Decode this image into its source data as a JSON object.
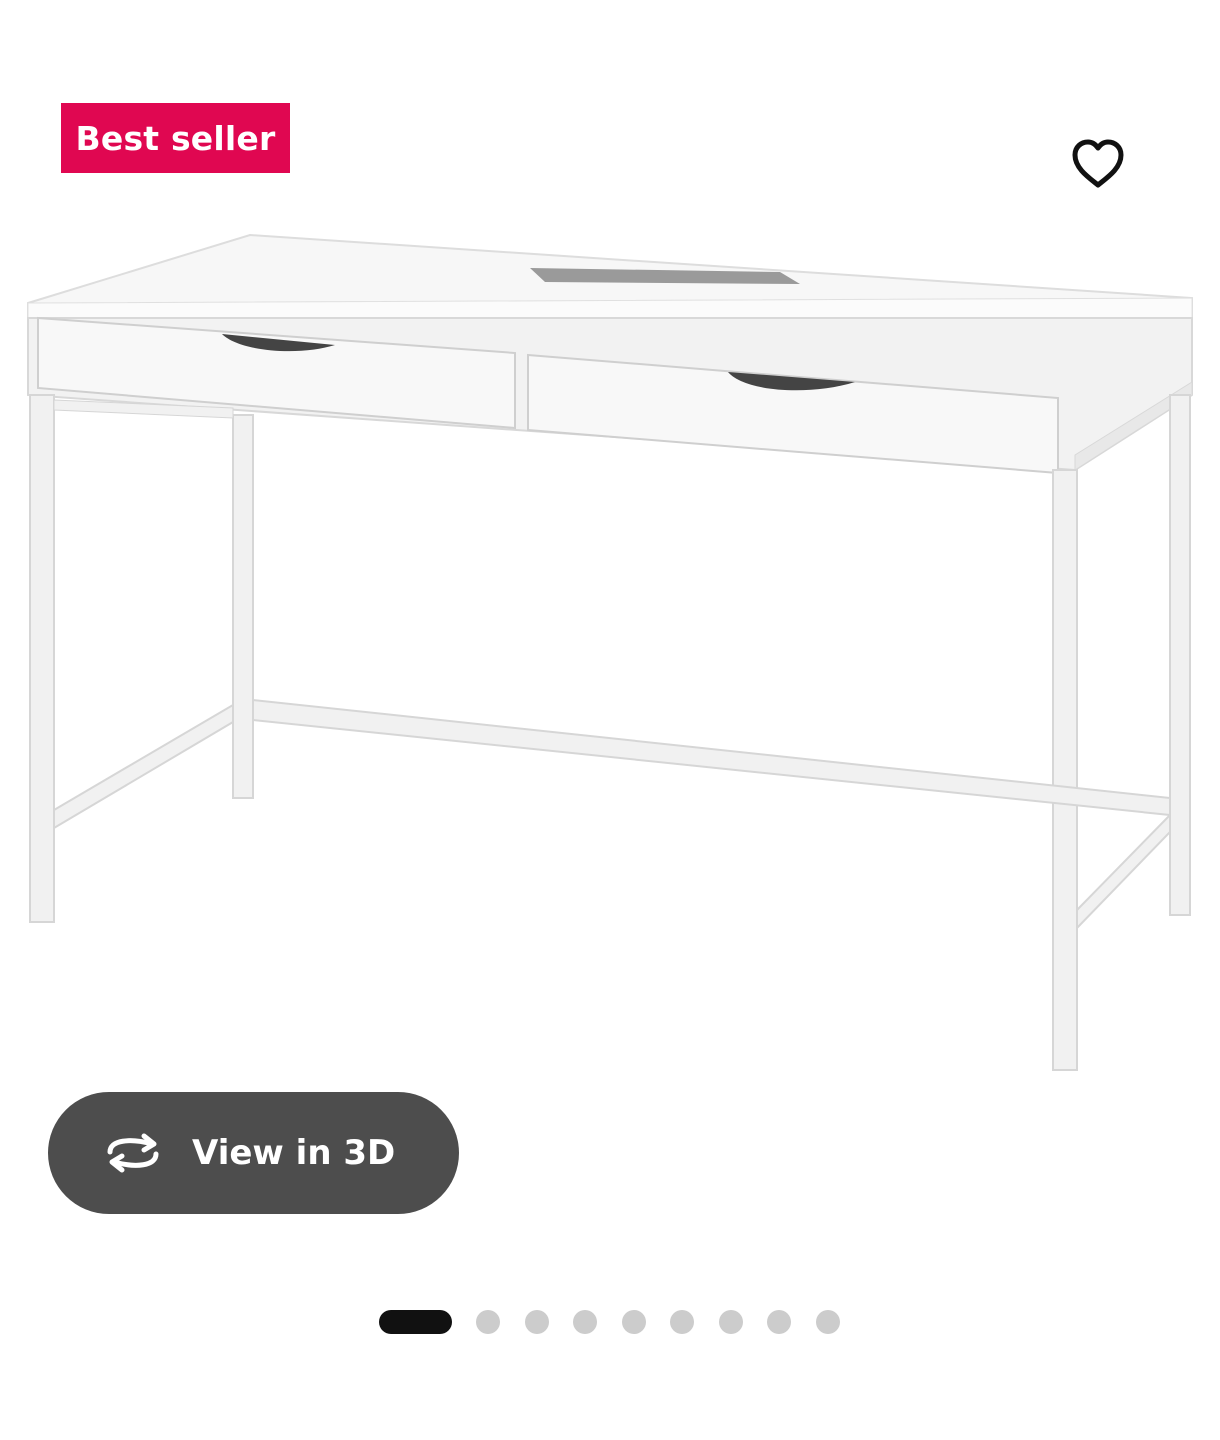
{
  "badge": {
    "label": "Best seller",
    "color": "#e00751"
  },
  "favorite": {
    "icon": "heart-outline-icon"
  },
  "product_image": {
    "alt": "White desk with two drawers and metal legs"
  },
  "view_3d": {
    "label": "View in 3D",
    "icon": "rotate-3d-icon",
    "background": "#4d4d4d"
  },
  "carousel": {
    "total_slides": 9,
    "active_index": 0,
    "active_color": "#111111",
    "inactive_color": "#cccccc"
  }
}
